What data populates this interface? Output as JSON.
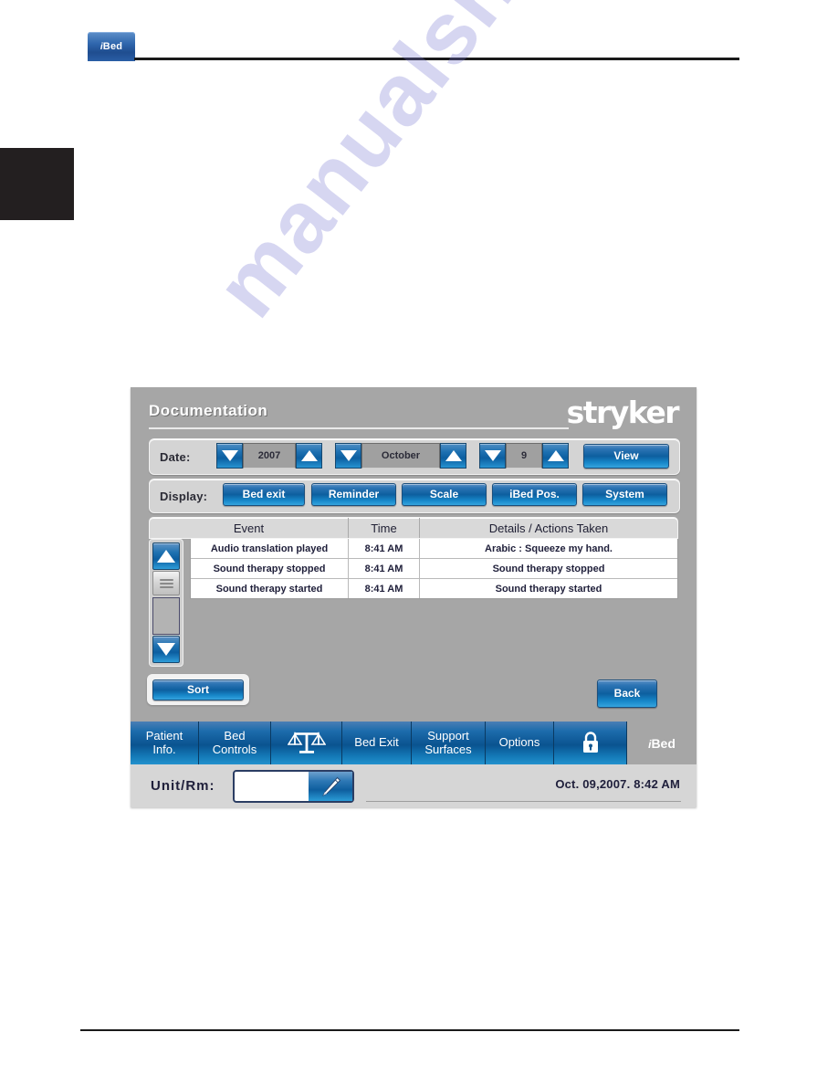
{
  "page": {
    "tab_label": "iBed",
    "tab_icon": "ibed-logo"
  },
  "watermark": {
    "text": "manualshlib.com"
  },
  "device": {
    "title": "Documentation",
    "brand": "stryker",
    "date_row": {
      "label": "Date:",
      "year": "2007",
      "month": "October",
      "day": "9",
      "view_button": "View",
      "down_icon": "triangle-down-icon",
      "up_icon": "triangle-up-icon"
    },
    "display_row": {
      "label": "Display:",
      "buttons": [
        {
          "label": "Bed exit"
        },
        {
          "label": "Reminder"
        },
        {
          "label": "Scale"
        },
        {
          "label": "iBed Pos."
        },
        {
          "label": "System"
        }
      ]
    },
    "table": {
      "columns": [
        "Event",
        "Time",
        "Details / Actions Taken"
      ],
      "rows": [
        {
          "event": "Audio translation played",
          "time": "8:41 AM",
          "details": "Arabic : Squeeze my hand."
        },
        {
          "event": "Sound therapy stopped",
          "time": "8:41 AM",
          "details": "Sound therapy stopped"
        },
        {
          "event": "Sound therapy started",
          "time": "8:41 AM",
          "details": "Sound therapy started"
        }
      ]
    },
    "scrollbar": {
      "up_icon": "scroll-up-arrow-icon",
      "down_icon": "scroll-down-arrow-icon",
      "thumb_icon": "scroll-thumb-grip-icon"
    },
    "actions": {
      "sort": "Sort",
      "back": "Back"
    },
    "navbar": {
      "items": [
        {
          "label": "Patient\nInfo.",
          "name": "patient-info",
          "icon": null,
          "width": 75
        },
        {
          "label": "Bed\nControls",
          "name": "bed-controls",
          "icon": null,
          "width": 79
        },
        {
          "label": "",
          "name": "scale",
          "icon": "scale-balance-icon",
          "width": 78
        },
        {
          "label": "Bed Exit",
          "name": "bed-exit",
          "icon": null,
          "width": 76
        },
        {
          "label": "Support\nSurfaces",
          "name": "support-surfaces",
          "icon": null,
          "width": 81
        },
        {
          "label": "Options",
          "name": "options",
          "icon": null,
          "width": 75
        },
        {
          "label": "",
          "name": "lock",
          "icon": "padlock-icon",
          "width": 80
        }
      ],
      "logo": "iBed"
    },
    "footer": {
      "unit_label": "Unit/Rm:",
      "unit_value": "",
      "unit_placeholder": "",
      "pencil_icon": "pencil-edit-icon",
      "datetime": "Oct. 09,2007. 8:42 AM"
    }
  },
  "colors": {
    "accent_blue": "#0d5f9f",
    "panel_gray": "#a6a6a6",
    "text_dark": "#1f1f3a"
  }
}
